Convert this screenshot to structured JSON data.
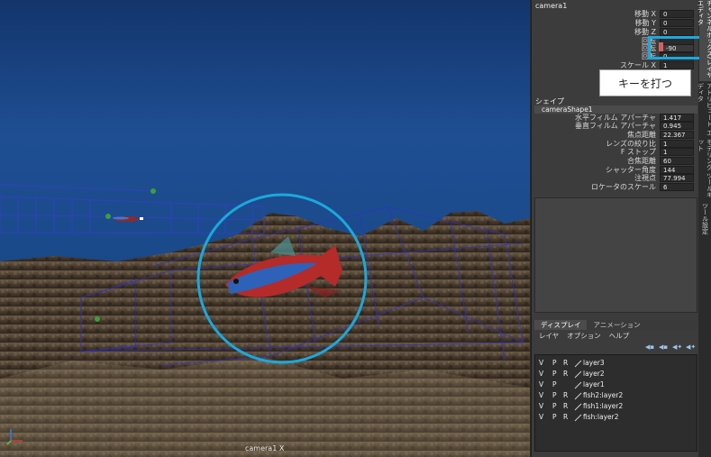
{
  "viewport": {
    "camera_label": "camera1 X"
  },
  "attribute_editor": {
    "node_title": "camera1",
    "transform_attrs": [
      {
        "label": "移動 X",
        "value": "0"
      },
      {
        "label": "移動 Y",
        "value": "0"
      },
      {
        "label": "移動 Z",
        "value": "0"
      },
      {
        "label": "回転",
        "value": ""
      },
      {
        "label": "回転",
        "value": "-90"
      },
      {
        "label": "回転",
        "value": "0"
      },
      {
        "label": "スケール X",
        "value": "1"
      }
    ],
    "tooltip": "キーを打つ",
    "shape_section": "シェイプ",
    "shape_node": "cameraShape1",
    "shape_attrs": [
      {
        "label": "水平フィルム アパーチャ",
        "value": "1.417"
      },
      {
        "label": "垂直フィルム アパーチャ",
        "value": "0.945"
      },
      {
        "label": "焦点距離",
        "value": "22.367"
      },
      {
        "label": "レンズの絞り比",
        "value": "1"
      },
      {
        "label": "F ストップ",
        "value": "1"
      },
      {
        "label": "合焦距離",
        "value": "60"
      },
      {
        "label": "シャッター角度",
        "value": "144"
      },
      {
        "label": "注視点",
        "value": "77.994"
      },
      {
        "label": "ロケータのスケール",
        "value": "6"
      }
    ]
  },
  "layer_editor": {
    "tabs": [
      "ディスプレイ",
      "アニメーション"
    ],
    "menus": [
      "レイヤ",
      "オプション",
      "ヘルプ"
    ],
    "layers": [
      {
        "v": "V",
        "p": "P",
        "r": "R",
        "name": "layer3"
      },
      {
        "v": "V",
        "p": "P",
        "r": "R",
        "name": "layer2"
      },
      {
        "v": "V",
        "p": "P",
        "r": "",
        "name": "layer1"
      },
      {
        "v": "V",
        "p": "P",
        "r": "R",
        "name": "fish2:layer2"
      },
      {
        "v": "V",
        "p": "P",
        "r": "R",
        "name": "fish1:layer2"
      },
      {
        "v": "V",
        "p": "P",
        "r": "R",
        "name": "fish:layer2"
      }
    ]
  },
  "side_tabs": [
    "チャンネルボックス/レイヤ エディタ",
    "アトリビュート エディタ",
    "モデリング ツールキット",
    "ツール設定"
  ],
  "colors": {
    "highlight": "#1ba8dd",
    "panel": "#3c3c3c",
    "fish_red": "#c0302a",
    "fish_blue": "#2a5ea8"
  }
}
